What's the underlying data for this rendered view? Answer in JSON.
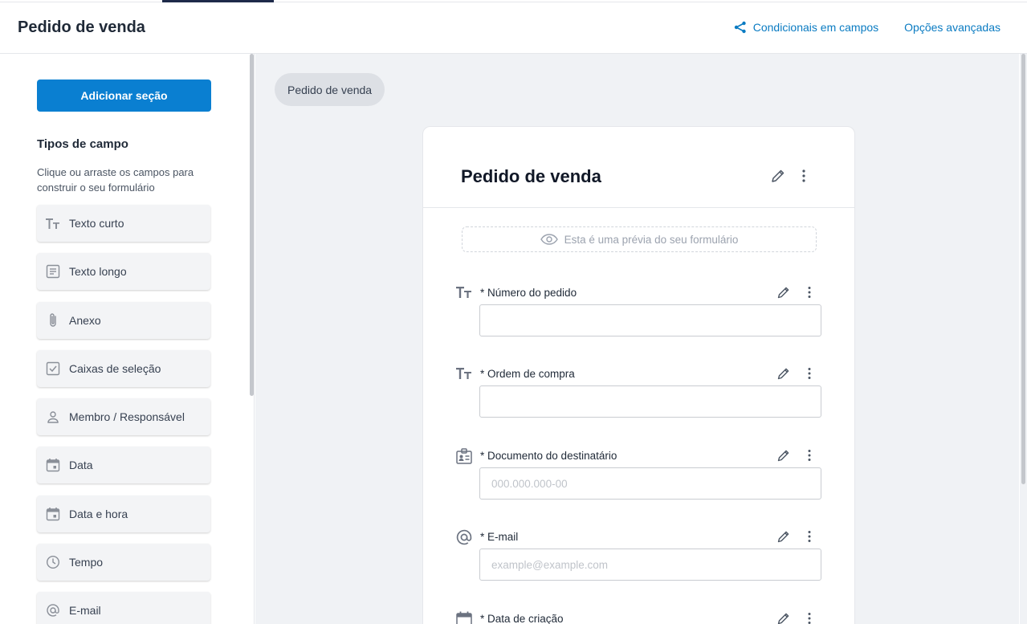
{
  "header": {
    "title": "Pedido de venda",
    "links": [
      {
        "label": "Condicionais em campos",
        "icon": "share-nodes-icon"
      },
      {
        "label": "Opções avançadas"
      }
    ]
  },
  "sidebar": {
    "add_section_label": "Adicionar seção",
    "field_types_title": "Tipos de campo",
    "field_types_description": "Clique ou arraste os campos para construir o seu formulário",
    "items": [
      {
        "label": "Texto curto",
        "icon": "short-text-icon"
      },
      {
        "label": "Texto longo",
        "icon": "long-text-icon"
      },
      {
        "label": "Anexo",
        "icon": "paperclip-icon"
      },
      {
        "label": "Caixas de seleção",
        "icon": "checkbox-icon"
      },
      {
        "label": "Membro / Responsável",
        "icon": "person-icon"
      },
      {
        "label": "Data",
        "icon": "calendar-icon"
      },
      {
        "label": "Data e hora",
        "icon": "calendar-icon"
      },
      {
        "label": "Tempo",
        "icon": "clock-icon"
      },
      {
        "label": "E-mail",
        "icon": "at-sign-icon"
      }
    ]
  },
  "main": {
    "section_chip": "Pedido de venda",
    "card_title": "Pedido de venda",
    "preview_banner": "Esta é uma prévia do seu formulário",
    "fields": [
      {
        "label": "* Número do pedido",
        "icon": "short-text-icon",
        "value": "",
        "placeholder": ""
      },
      {
        "label": "* Ordem de compra",
        "icon": "short-text-icon",
        "value": "",
        "placeholder": ""
      },
      {
        "label": "* Documento do destinatário",
        "icon": "id-card-icon",
        "value": "",
        "placeholder": "000.000.000-00"
      },
      {
        "label": "* E-mail",
        "icon": "at-sign-icon",
        "value": "",
        "placeholder": "example@example.com"
      },
      {
        "label": "* Data de criação",
        "icon": "calendar-icon",
        "value": "",
        "placeholder": ""
      }
    ]
  },
  "colors": {
    "accent": "#0a7fd1",
    "link": "#0a7bc2",
    "canvas": "#f0f2f5"
  }
}
